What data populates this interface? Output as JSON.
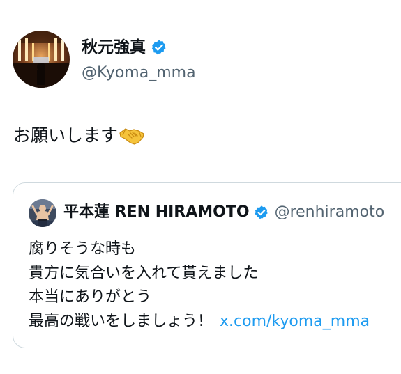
{
  "author": {
    "display_name": "秋元強真",
    "handle": "@Kyoma_mma",
    "verified": true
  },
  "tweet": {
    "text": "お願いします",
    "emoji": "handshake"
  },
  "quoted_tweet": {
    "display_name": "平本蓮 REN HIRAMOTO",
    "handle": "@renhiramoto",
    "verified": true,
    "lines": [
      "腐りそうな時も",
      "貴方に気合いを入れて貰えました",
      "本当にありがとう",
      "最高の戦いをしましょう！"
    ],
    "link_text": "x.com/kyoma_mma"
  },
  "colors": {
    "text": "#0f1419",
    "secondary": "#536471",
    "link": "#1d9bf0",
    "verified_badge": "#1d9bf0",
    "card_border": "#cfd9de"
  }
}
